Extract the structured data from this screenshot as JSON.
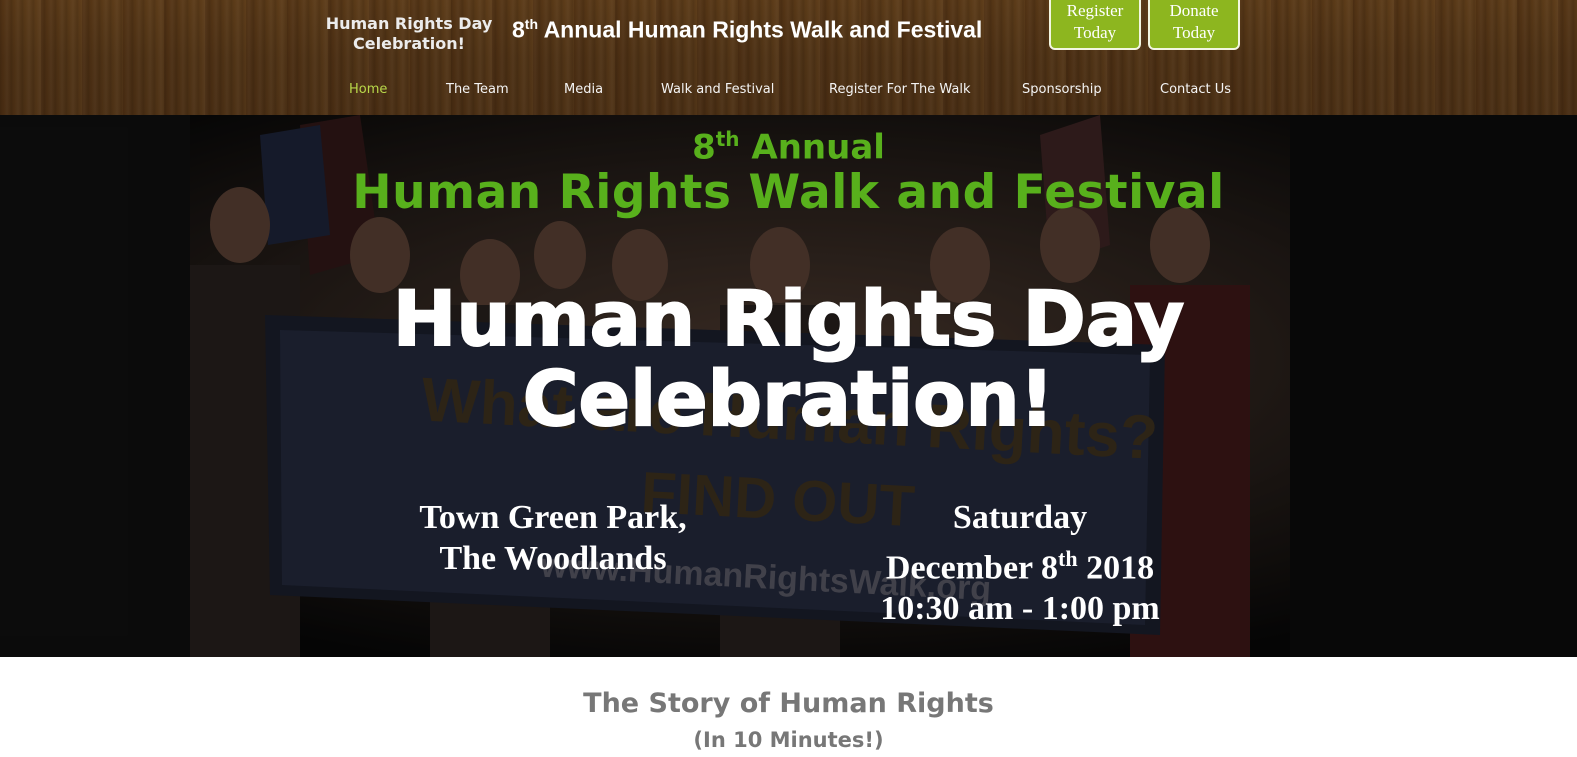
{
  "header": {
    "site_title_line1": "Human Rights Day",
    "site_title_line2": "Celebration!",
    "heading_ordinal": "8",
    "heading_suffix": "th",
    "heading_rest": "Annual Human Rights Walk and Festival",
    "register_line1": "Register",
    "register_line2": "Today",
    "donate_line1": "Donate",
    "donate_line2": "Today"
  },
  "nav": {
    "items": [
      {
        "label": "Home",
        "active": true
      },
      {
        "label": "The Team"
      },
      {
        "label": "Media"
      },
      {
        "label": "Walk and Festival"
      },
      {
        "label": "Register For The Walk"
      },
      {
        "label": "Sponsorship"
      },
      {
        "label": "Contact Us"
      }
    ]
  },
  "hero": {
    "annual_ordinal": "8",
    "annual_suffix": "th",
    "annual_rest": "Annual",
    "title": "Human Rights Walk and Festival",
    "celebration_line1": "Human Rights Day",
    "celebration_line2": "Celebration!",
    "location_line1": "Town Green Park,",
    "location_line2": "The Woodlands",
    "date_day": "Saturday",
    "date_prefix": "December 8",
    "date_suffix": "th",
    "date_year": "2018",
    "date_time": "10:30 am - 1:00 pm"
  },
  "story": {
    "title": "The Story of Human Rights",
    "subtitle": "(In 10 Minutes!)"
  },
  "colors": {
    "accent_green": "#58b01c",
    "button_green": "#8db61f",
    "nav_active": "#b9d84a",
    "header_brown": "#4e3215"
  }
}
